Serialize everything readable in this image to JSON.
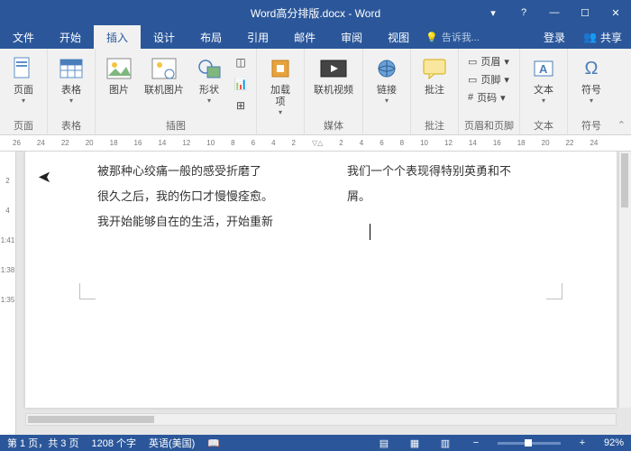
{
  "title": "Word高分排版.docx - Word",
  "menu": {
    "file": "文件",
    "home": "开始",
    "insert": "插入",
    "design": "设计",
    "layout": "布局",
    "references": "引用",
    "mailings": "邮件",
    "review": "审阅",
    "view": "视图",
    "tellme": "告诉我...",
    "login": "登录",
    "share": "共享"
  },
  "ribbon": {
    "pages": {
      "label": "页面",
      "page": "页面"
    },
    "tables": {
      "label": "表格",
      "table": "表格"
    },
    "illustrations": {
      "label": "插图",
      "picture": "图片",
      "online": "联机图片",
      "shapes": "形状"
    },
    "addins": {
      "label": "加载\n项",
      "title": "加载项"
    },
    "media": {
      "label": "媒体",
      "video": "联机视频"
    },
    "links": {
      "label": "链接",
      "link": "链接"
    },
    "comments": {
      "label": "批注",
      "comment": "批注"
    },
    "headerfooter": {
      "label": "页眉和页脚",
      "header": "页眉",
      "footer": "页脚",
      "pagenum": "页码"
    },
    "text": {
      "label": "文本",
      "textbox": "文本"
    },
    "symbols": {
      "label": "符号",
      "symbol": "符号"
    }
  },
  "ruler_h": [
    "26",
    "24",
    "22",
    "20",
    "18",
    "16",
    "14",
    "12",
    "10",
    "8",
    "6",
    "4",
    "2",
    "",
    "2",
    "4",
    "6",
    "8",
    "10",
    "12",
    "14",
    "16",
    "18",
    "20",
    "22",
    "24"
  ],
  "ruler_v": [
    "",
    "2",
    "4",
    "1:41",
    "1:38",
    "1:35"
  ],
  "document": {
    "col1_l1": "被那种心绞痛一般的感受折磨了",
    "col1_l2": "很久之后，我的伤口才慢慢痊愈。",
    "col1_l3": "我开始能够自在的生活，开始重新",
    "col2_l1": "我们一个个表现得特别英勇和不",
    "col2_l2": "屑。"
  },
  "status": {
    "page": "第 1 页，共 3 页",
    "words": "1208 个字",
    "lang": "英语(美国)",
    "zoom": "92%"
  }
}
